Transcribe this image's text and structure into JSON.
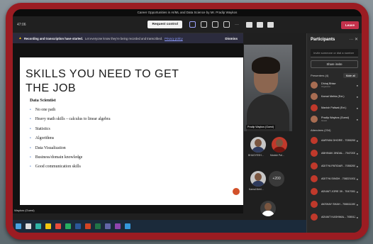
{
  "window": {
    "title": "Career Opportunities in AI/ML and Data Science by Mr. Pradip Waykos"
  },
  "toolbar": {
    "time": "47:06",
    "request_control": "Request control"
  },
  "meeting_controls": {
    "leave_label": "Leave"
  },
  "banner": {
    "bold_text": "Recording and transcription have started.",
    "text": "Let everyone know they're being recorded and transcribed.",
    "link": "Privacy policy",
    "dismiss": "Dismiss"
  },
  "slide": {
    "title": "SKILLS YOU NEED TO GET THE JOB",
    "subtitle": "Data Scientist",
    "bullets": [
      "No one path",
      "Heavy math skills – calculus to linear algebra",
      "Statistics",
      "Algorithms",
      "Data Visualization",
      "Business/domain knowledge",
      "Good communication skills"
    ],
    "presenter_label": "Waykos (Guest)"
  },
  "video_grid": {
    "main_label": "Pradip Waykos (Guest)",
    "tiles": [
      {
        "name": "BHAGYESH..."
      },
      {
        "name": "Manish Pal..."
      },
      {
        "name": "Kamal Mehl..."
      }
    ],
    "more_count": "+200"
  },
  "participants_panel": {
    "title": "Participants",
    "search_placeholder": "Invite someone or dial a number",
    "share_invite": "Share invite",
    "presenters_header": "Presenters (4)",
    "mute_all": "Mute all",
    "presenters": [
      {
        "name": "Dhiraj Bhise",
        "role": "Organizer"
      },
      {
        "name": "Kamal Mehta (Ext.)",
        "role": ""
      },
      {
        "name": "Manish Paliwal (Ext.)",
        "role": ""
      },
      {
        "name": "Pradip Waykos (Guest)",
        "role": "Guest"
      }
    ],
    "attendees_header": "Attendees (234)",
    "attendees": [
      {
        "name": "AARYAN DHORE - 7055200..."
      },
      {
        "name": "ABHINAV JINDAL - 7047200..."
      },
      {
        "name": "ADITYA PATIDAR - 7055200..."
      },
      {
        "name": "ADITYA SINGH - 70822100257"
      },
      {
        "name": "ADVAIT JORE 39 - 70470019..."
      },
      {
        "name": "AKSHAY SHAH - 70661119033"
      },
      {
        "name": "ADVAIT KASHWAL - 7055120..."
      }
    ]
  },
  "colors": {
    "frame": "#9b1c22",
    "leave": "#c4314b",
    "link": "#8c9cff",
    "bullet": "#1f5fbf"
  }
}
